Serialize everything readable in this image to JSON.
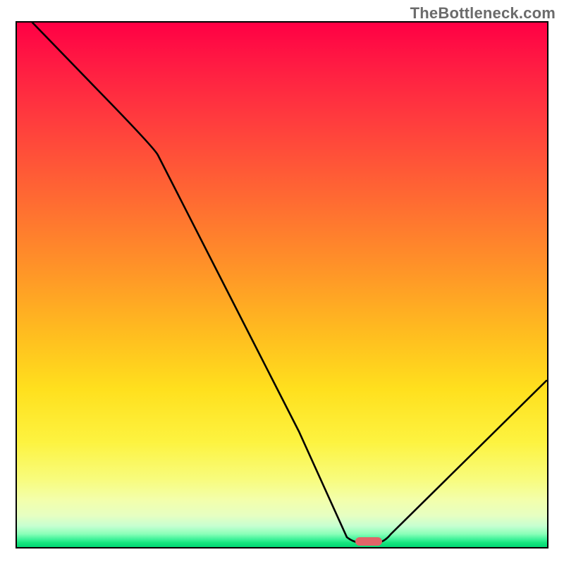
{
  "watermark": "TheBottleneck.com",
  "colors": {
    "frame_border": "#000000",
    "curve_stroke": "#000000",
    "marker_fill": "#e16468",
    "gradient_top": "#ff0044",
    "gradient_bottom": "#02d574"
  },
  "chart_data": {
    "type": "line",
    "title": "",
    "xlabel": "",
    "ylabel": "",
    "xlim": [
      0,
      100
    ],
    "ylim": [
      0,
      100
    ],
    "x": [
      3,
      15,
      26,
      53,
      62,
      64,
      68,
      70,
      100
    ],
    "values": [
      100,
      87,
      73,
      22,
      2,
      1,
      1,
      2,
      32
    ],
    "marker": {
      "x_start": 64,
      "x_end": 68,
      "y": 0.8
    },
    "notes": "Single black curve descending steeply from top-left, flattening briefly at bottom around x≈64–68 (red marker segment), then rising toward right edge; no axis ticks or labels visible."
  }
}
